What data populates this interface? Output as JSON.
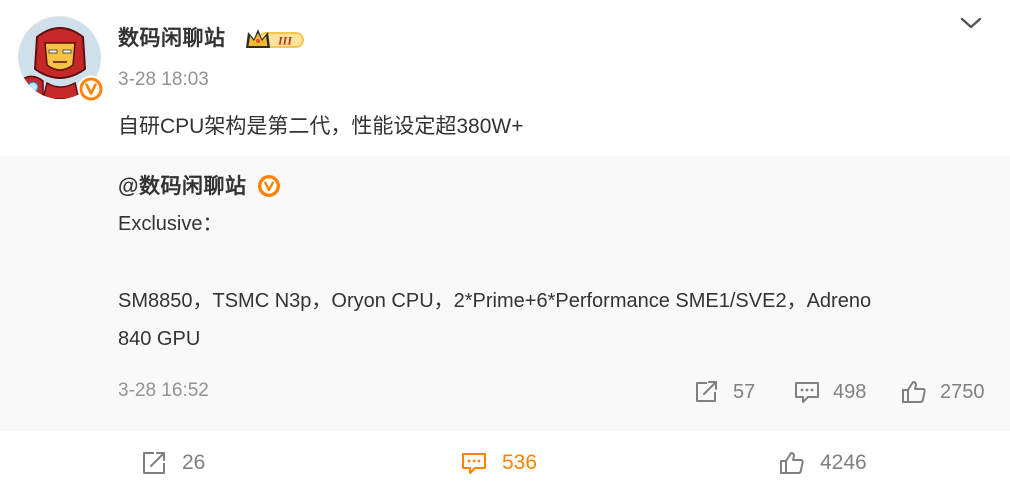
{
  "post": {
    "author": {
      "name": "数码闲聊站",
      "avatar_icon": "iron-man-avatar",
      "verified_icon": "orange-v-badge",
      "rank_badge": "III"
    },
    "time": "3-28 18:03",
    "text": "自研CPU架构是第二代，性能设定超380W+",
    "more_icon": "chevron-down-icon"
  },
  "retweet": {
    "author": "@数码闲聊站",
    "lines": [
      "Exclusive：",
      "SM8850，TSMC N3p，Oryon CPU，2*Prime+6*Performance SME1/SVE2，Adreno",
      "840 GPU"
    ],
    "time": "3-28 16:52",
    "stats": {
      "forwards": "57",
      "comments": "498",
      "likes": "2750"
    }
  },
  "toolbar": {
    "forward_count": "26",
    "comment_count": "536",
    "like_count": "4246"
  },
  "colors": {
    "accent": "#ff8200",
    "muted": "#939393",
    "text": "#333333",
    "repost_bg": "#f9f9f9"
  }
}
